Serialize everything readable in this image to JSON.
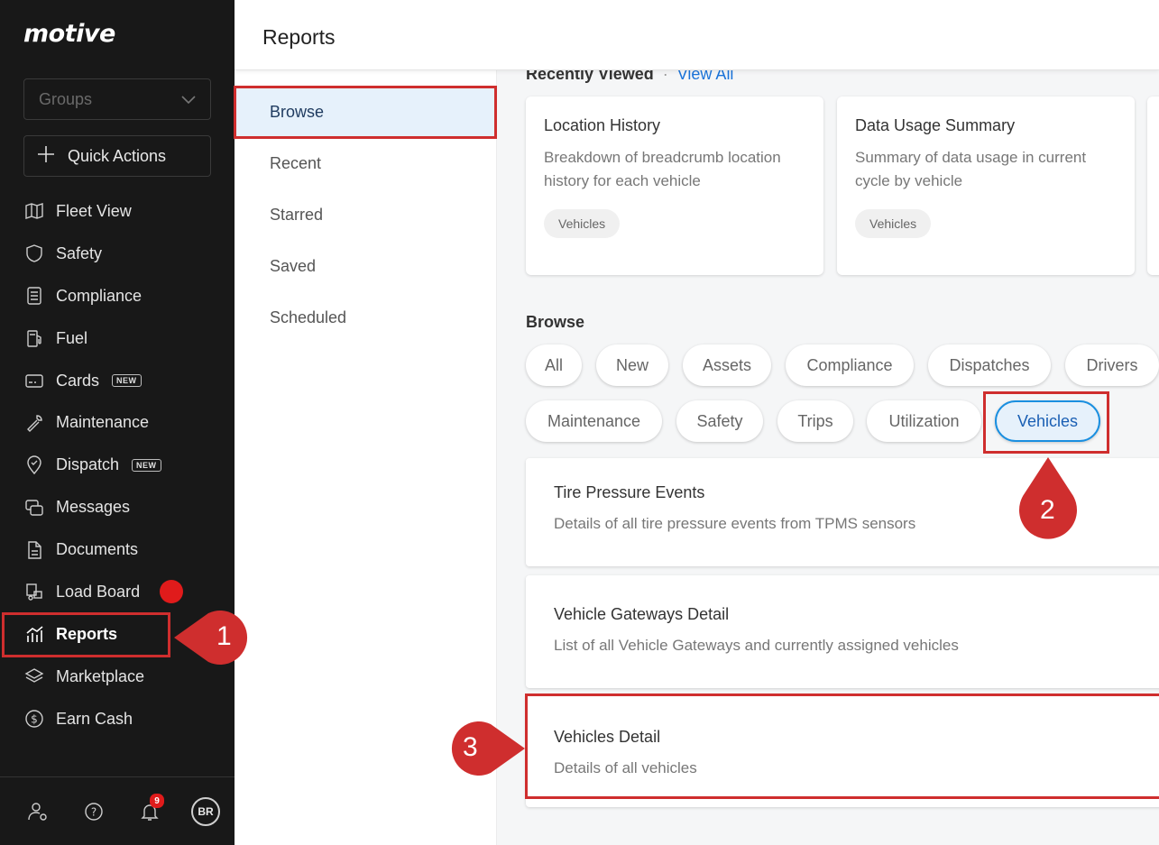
{
  "app": {
    "logo": "motive",
    "page_title": "Reports"
  },
  "sidebar": {
    "groups_placeholder": "Groups",
    "quick_actions": "Quick Actions",
    "items": [
      {
        "label": "Fleet View",
        "icon": "map-icon"
      },
      {
        "label": "Safety",
        "icon": "shield-icon"
      },
      {
        "label": "Compliance",
        "icon": "document-list-icon"
      },
      {
        "label": "Fuel",
        "icon": "fuel-pump-icon"
      },
      {
        "label": "Cards",
        "icon": "card-icon",
        "badge": "NEW"
      },
      {
        "label": "Maintenance",
        "icon": "wrench-icon"
      },
      {
        "label": "Dispatch",
        "icon": "location-pin-icon",
        "badge": "NEW"
      },
      {
        "label": "Messages",
        "icon": "chat-icon"
      },
      {
        "label": "Documents",
        "icon": "file-icon"
      },
      {
        "label": "Load Board",
        "icon": "truck-box-icon"
      },
      {
        "label": "Reports",
        "icon": "chart-icon",
        "active": true
      },
      {
        "label": "Marketplace",
        "icon": "layers-icon"
      },
      {
        "label": "Earn Cash",
        "icon": "dollar-coin-icon"
      }
    ],
    "notification_count": "9",
    "avatar_initials": "BR"
  },
  "subnav": {
    "items": [
      "Browse",
      "Recent",
      "Starred",
      "Saved",
      "Scheduled"
    ],
    "active": "Browse"
  },
  "recently_viewed": {
    "heading": "Recently Viewed",
    "view_all": "View All",
    "cards": [
      {
        "title": "Location History",
        "description": "Breakdown of breadcrumb location history for each vehicle",
        "tag": "Vehicles"
      },
      {
        "title": "Data Usage Summary",
        "description": "Summary of data usage in current cycle by vehicle",
        "tag": "Vehicles"
      }
    ]
  },
  "browse": {
    "heading": "Browse",
    "filters_row1": [
      "All",
      "New",
      "Assets",
      "Compliance",
      "Dispatches",
      "Drivers"
    ],
    "filters_row2": [
      "Maintenance",
      "Safety",
      "Trips",
      "Utilization",
      "Vehicles"
    ],
    "selected_filter": "Vehicles",
    "reports": [
      {
        "title": "Tire Pressure Events",
        "description": "Details of all tire pressure events from TPMS sensors"
      },
      {
        "title": "Vehicle Gateways Detail",
        "description": "List of all Vehicle Gateways and currently assigned vehicles"
      },
      {
        "title": "Vehicles Detail",
        "description": "Details of all vehicles"
      }
    ]
  },
  "annotations": {
    "step1": "1",
    "step2": "2",
    "step3": "3",
    "color": "#cf2e2e"
  }
}
